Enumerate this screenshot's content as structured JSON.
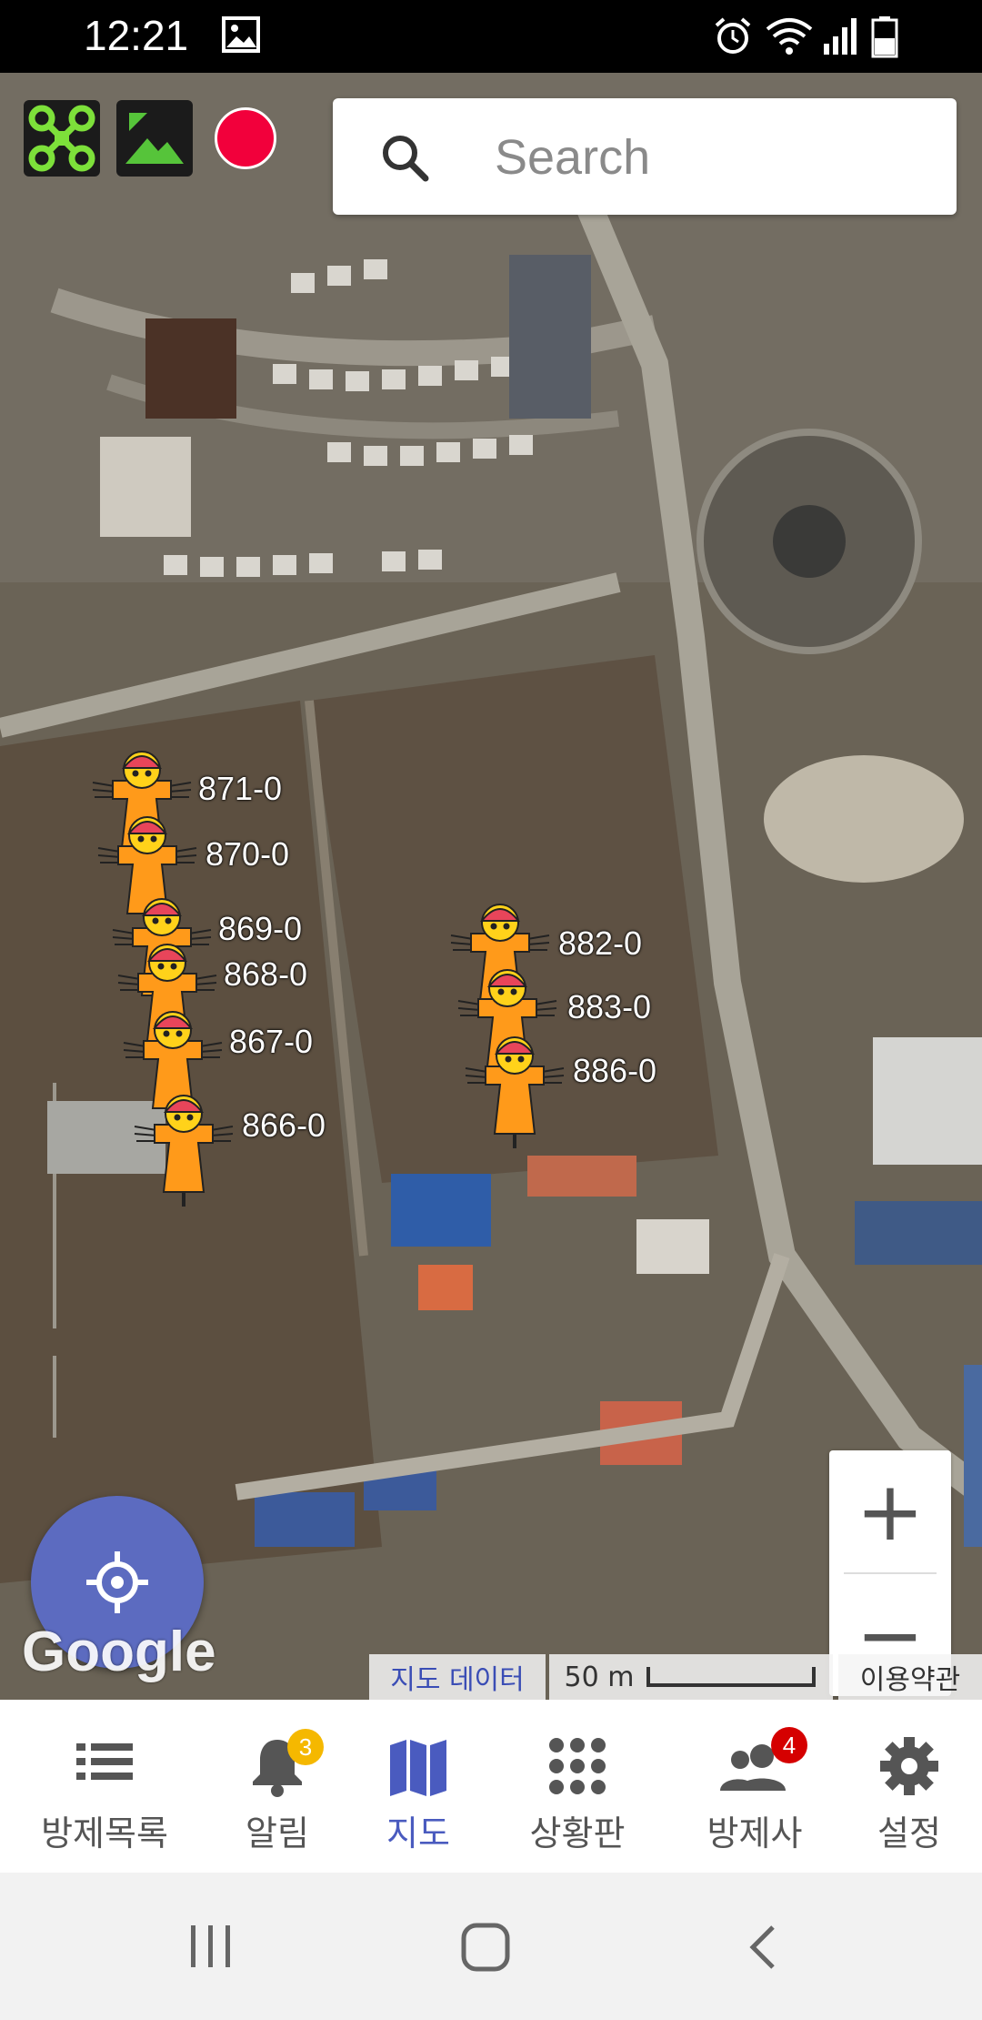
{
  "status_bar": {
    "time": "12:21"
  },
  "toolbar": {
    "drone_icon": "drone-icon",
    "terrain_icon": "terrain-icon",
    "record_color": "#f2003b"
  },
  "search": {
    "placeholder": "Search"
  },
  "markers": [
    {
      "label": "871-0"
    },
    {
      "label": "870-0"
    },
    {
      "label": "869-0"
    },
    {
      "label": "868-0"
    },
    {
      "label": "867-0"
    },
    {
      "label": "866-0"
    },
    {
      "label": "882-0"
    },
    {
      "label": "883-0"
    },
    {
      "label": "886-0"
    }
  ],
  "map": {
    "watermark": "Google",
    "data_link": "지도 데이터",
    "scale": "50 m",
    "terms": "이용약관",
    "zoom_in": "+",
    "zoom_out": "−"
  },
  "nav": {
    "items": [
      {
        "label": "방제목록",
        "icon": "list-icon"
      },
      {
        "label": "알림",
        "icon": "bell-icon",
        "badge": "3"
      },
      {
        "label": "지도",
        "icon": "map-icon",
        "active": true
      },
      {
        "label": "상황판",
        "icon": "grid-icon"
      },
      {
        "label": "방제사",
        "icon": "people-icon",
        "badge": "4"
      },
      {
        "label": "설정",
        "icon": "gear-icon"
      }
    ]
  },
  "colors": {
    "accent": "#4a5bbf",
    "locate_button": "#5c6bc0",
    "badge_yellow": "#f5b800",
    "badge_red": "#d50000",
    "marker_orange": "#ff9a1a"
  }
}
